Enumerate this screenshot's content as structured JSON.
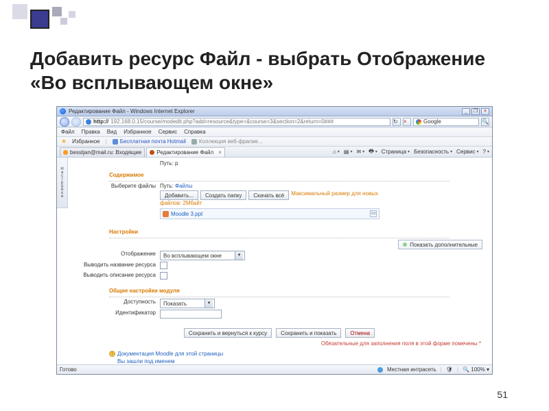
{
  "slide": {
    "title": "Добавить ресурс Файл - выбрать Отображение «Во всплывающем окне»",
    "page_number": "51"
  },
  "browser": {
    "window_title": "Редактирование Файл - Windows Internet Explorer",
    "min": "_",
    "max": "▢",
    "restore": "❐",
    "close": "×",
    "url_protocol": "http://",
    "url_rest": "192.168.0.15/course/modedit.php?add=resource&type=&course=3&section=2&return=0###",
    "search_engine": "Google",
    "menus": [
      "Файл",
      "Правка",
      "Вид",
      "Избранное",
      "Сервис",
      "Справка"
    ],
    "fav_label": "Избранное",
    "fav_links": [
      "Бесплатная почта Hotmail",
      "Коллекция веб-фрагме..."
    ],
    "tabs": [
      {
        "label": "besstjan@mail.ru: Входящие"
      },
      {
        "label": "Редактирование Файл"
      }
    ],
    "toolbar": {
      "home": "⌂",
      "feeds": "▤",
      "mail": "✉",
      "print": "🖶",
      "page": "Страница",
      "safety": "Безопасность",
      "service": "Сервис",
      "help": "?"
    },
    "status": {
      "done": "Готово",
      "zone": "Местная интрасеть",
      "zoom": "100%"
    }
  },
  "form": {
    "sidebar_tab": "Настройки",
    "name_label": "Путь: p",
    "section_content": "Содержимое",
    "choose_files": "Выберите файлы",
    "path_prefix": "Путь:",
    "path_value": "Файлы",
    "btn_add": "Добавить...",
    "btn_mkdir": "Создать папку",
    "btn_dl_all": "Скачать всё",
    "max_note": "Максимальный размер для новых",
    "max_note2": "файлов: 2Мбайт",
    "file_name": "Moodle 3.ppt",
    "section_settings": "Настройки",
    "show_advanced": "Показать дополнительные",
    "display_label": "Отображение",
    "display_value": "Во всплывающем окне",
    "show_name_label": "Выводить название ресурса",
    "show_desc_label": "Выводить описание ресурса",
    "section_general": "Общие настройки модуля",
    "availability_label": "Доступность",
    "availability_value": "Показать",
    "id_label": "Идентификатор",
    "btn_save_return": "Сохранить и вернуться к курсу",
    "btn_save_show": "Сохранить и показать",
    "btn_cancel": "Отмена",
    "required_note": "Обязательные для заполнения поля в этой форме помечены *",
    "doc_link": "Документация Moodle для этой страницы",
    "login_link": "Вы зашли под именем"
  }
}
